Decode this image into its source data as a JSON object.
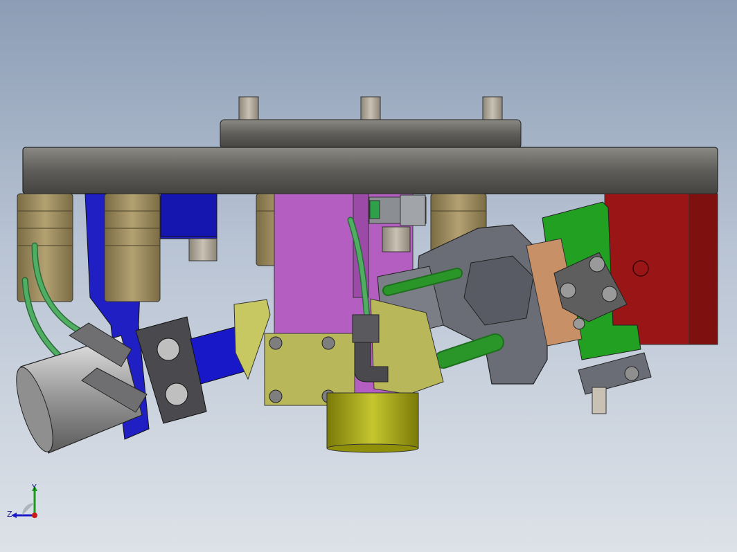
{
  "triad": {
    "x_label": "",
    "y_label": "Y",
    "z_label": "Z"
  },
  "colors": {
    "plate": "#6b6965",
    "plate_dark": "#3a3936",
    "bushing": "#9b8a5c",
    "blue_part": "#1b1bd0",
    "magenta_block": "#b45fc0",
    "yellow_part": "#b3b35a",
    "olive_cup": "#9a9a10",
    "red_block": "#a01818",
    "green_bracket": "#1d9a1d",
    "grey_housing": "#6c6f78",
    "hose_green": "#3e9f55",
    "copper": "#c89066"
  }
}
